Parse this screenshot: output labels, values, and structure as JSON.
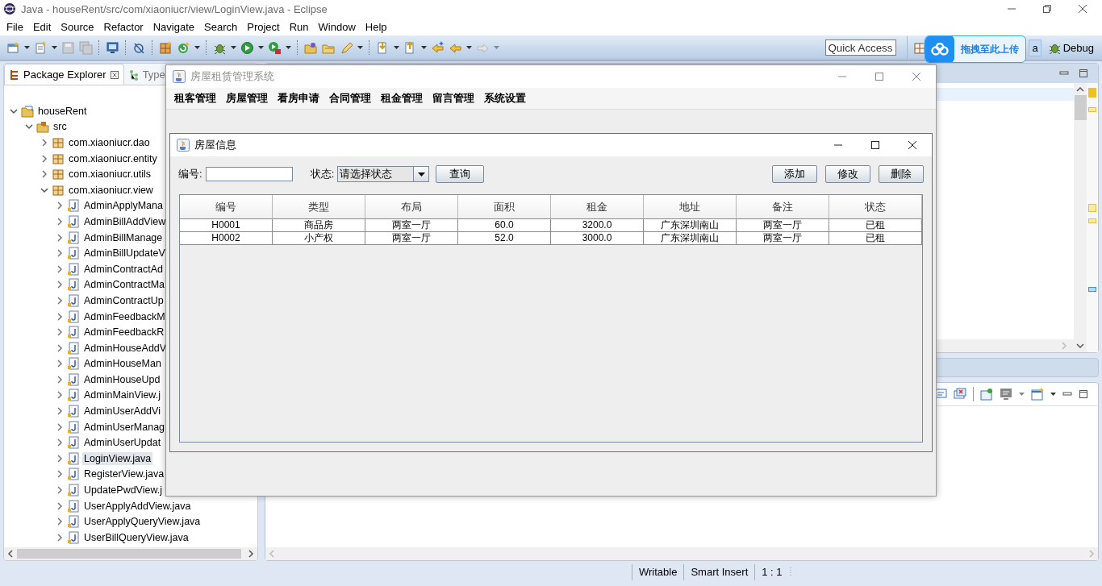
{
  "window": {
    "title": "Java - houseRent/src/com/xiaoniucr/view/LoginView.java - Eclipse"
  },
  "menu": [
    "File",
    "Edit",
    "Source",
    "Refactor",
    "Navigate",
    "Search",
    "Project",
    "Run",
    "Window",
    "Help"
  ],
  "quick_access": {
    "placeholder": "Quick Access"
  },
  "perspectives": [
    {
      "label": "a",
      "selected": true
    },
    {
      "label": "Debug",
      "selected": false
    }
  ],
  "upload_badge": {
    "label": "拖拽至此上传"
  },
  "left_tabs": [
    {
      "label": "Package Explorer",
      "selected": true
    },
    {
      "label": "Type",
      "selected": false
    }
  ],
  "tree": [
    {
      "label": "houseRent",
      "kind": "project",
      "expanded": true,
      "selected": false,
      "children": [
        {
          "label": "src",
          "kind": "folder",
          "expanded": true,
          "selected": false,
          "children": [
            {
              "label": "com.xiaoniucr.dao",
              "kind": "package",
              "expanded": false,
              "selected": false
            },
            {
              "label": "com.xiaoniucr.entity",
              "kind": "package",
              "expanded": false,
              "selected": false
            },
            {
              "label": "com.xiaoniucr.utils",
              "kind": "package",
              "expanded": false,
              "selected": false
            },
            {
              "label": "com.xiaoniucr.view",
              "kind": "package",
              "expanded": true,
              "selected": false,
              "children": [
                {
                  "label": "AdminApplyMana",
                  "kind": "file",
                  "expanded": false,
                  "selected": false
                },
                {
                  "label": "AdminBillAddView",
                  "kind": "file",
                  "expanded": false,
                  "selected": false
                },
                {
                  "label": "AdminBillManage",
                  "kind": "file",
                  "expanded": false,
                  "selected": false
                },
                {
                  "label": "AdminBillUpdateV",
                  "kind": "file",
                  "expanded": false,
                  "selected": false
                },
                {
                  "label": "AdminContractAd",
                  "kind": "file",
                  "expanded": false,
                  "selected": false
                },
                {
                  "label": "AdminContractMa",
                  "kind": "file",
                  "expanded": false,
                  "selected": false
                },
                {
                  "label": "AdminContractUp",
                  "kind": "file",
                  "expanded": false,
                  "selected": false
                },
                {
                  "label": "AdminFeedbackM",
                  "kind": "file",
                  "expanded": false,
                  "selected": false
                },
                {
                  "label": "AdminFeedbackR",
                  "kind": "file",
                  "expanded": false,
                  "selected": false
                },
                {
                  "label": "AdminHouseAddV",
                  "kind": "file",
                  "expanded": false,
                  "selected": false
                },
                {
                  "label": "AdminHouseMan",
                  "kind": "file",
                  "expanded": false,
                  "selected": false
                },
                {
                  "label": "AdminHouseUpd",
                  "kind": "file",
                  "expanded": false,
                  "selected": false
                },
                {
                  "label": "AdminMainView.j",
                  "kind": "file",
                  "expanded": false,
                  "selected": false
                },
                {
                  "label": "AdminUserAddVi",
                  "kind": "file",
                  "expanded": false,
                  "selected": false
                },
                {
                  "label": "AdminUserManag",
                  "kind": "file",
                  "expanded": false,
                  "selected": false
                },
                {
                  "label": "AdminUserUpdat",
                  "kind": "file",
                  "expanded": false,
                  "selected": false
                },
                {
                  "label": "LoginView.java",
                  "kind": "file",
                  "expanded": false,
                  "selected": true
                },
                {
                  "label": "RegisterView.java",
                  "kind": "file",
                  "expanded": false,
                  "selected": false
                },
                {
                  "label": "UpdatePwdView.j",
                  "kind": "file",
                  "expanded": false,
                  "selected": false
                },
                {
                  "label": "UserApplyAddView.java",
                  "kind": "file",
                  "expanded": false,
                  "selected": false
                },
                {
                  "label": "UserApplyQueryView.java",
                  "kind": "file",
                  "expanded": false,
                  "selected": false
                },
                {
                  "label": "UserBillQueryView.java",
                  "kind": "file",
                  "expanded": false,
                  "selected": false
                }
              ]
            }
          ]
        }
      ]
    }
  ],
  "status_bar": [
    "Writable",
    "Smart Insert",
    "1 : 1"
  ],
  "app_window": {
    "title": "房屋租赁管理系统",
    "menu": [
      "租客管理",
      "房屋管理",
      "看房申请",
      "合同管理",
      "租金管理",
      "留言管理",
      "系统设置"
    ],
    "frame": {
      "title": "房屋信息",
      "id_label": "编号:",
      "status_label": "状态:",
      "status_value": "请选择状态",
      "buttons_left": [
        "查询"
      ],
      "buttons_right": [
        "添加",
        "修改",
        "删除"
      ],
      "table": {
        "columns": [
          "编号",
          "类型",
          "布局",
          "面积",
          "租金",
          "地址",
          "备注",
          "状态"
        ],
        "rows": [
          [
            "H0001",
            "商品房",
            "两室一厅",
            "60.0",
            "3200.0",
            "广东深圳南山",
            "两室一厅",
            "已租"
          ],
          [
            "H0002",
            "小产权",
            "两室一厅",
            "52.0",
            "3000.0",
            "广东深圳南山",
            "两室一厅",
            "已租"
          ]
        ]
      }
    }
  }
}
